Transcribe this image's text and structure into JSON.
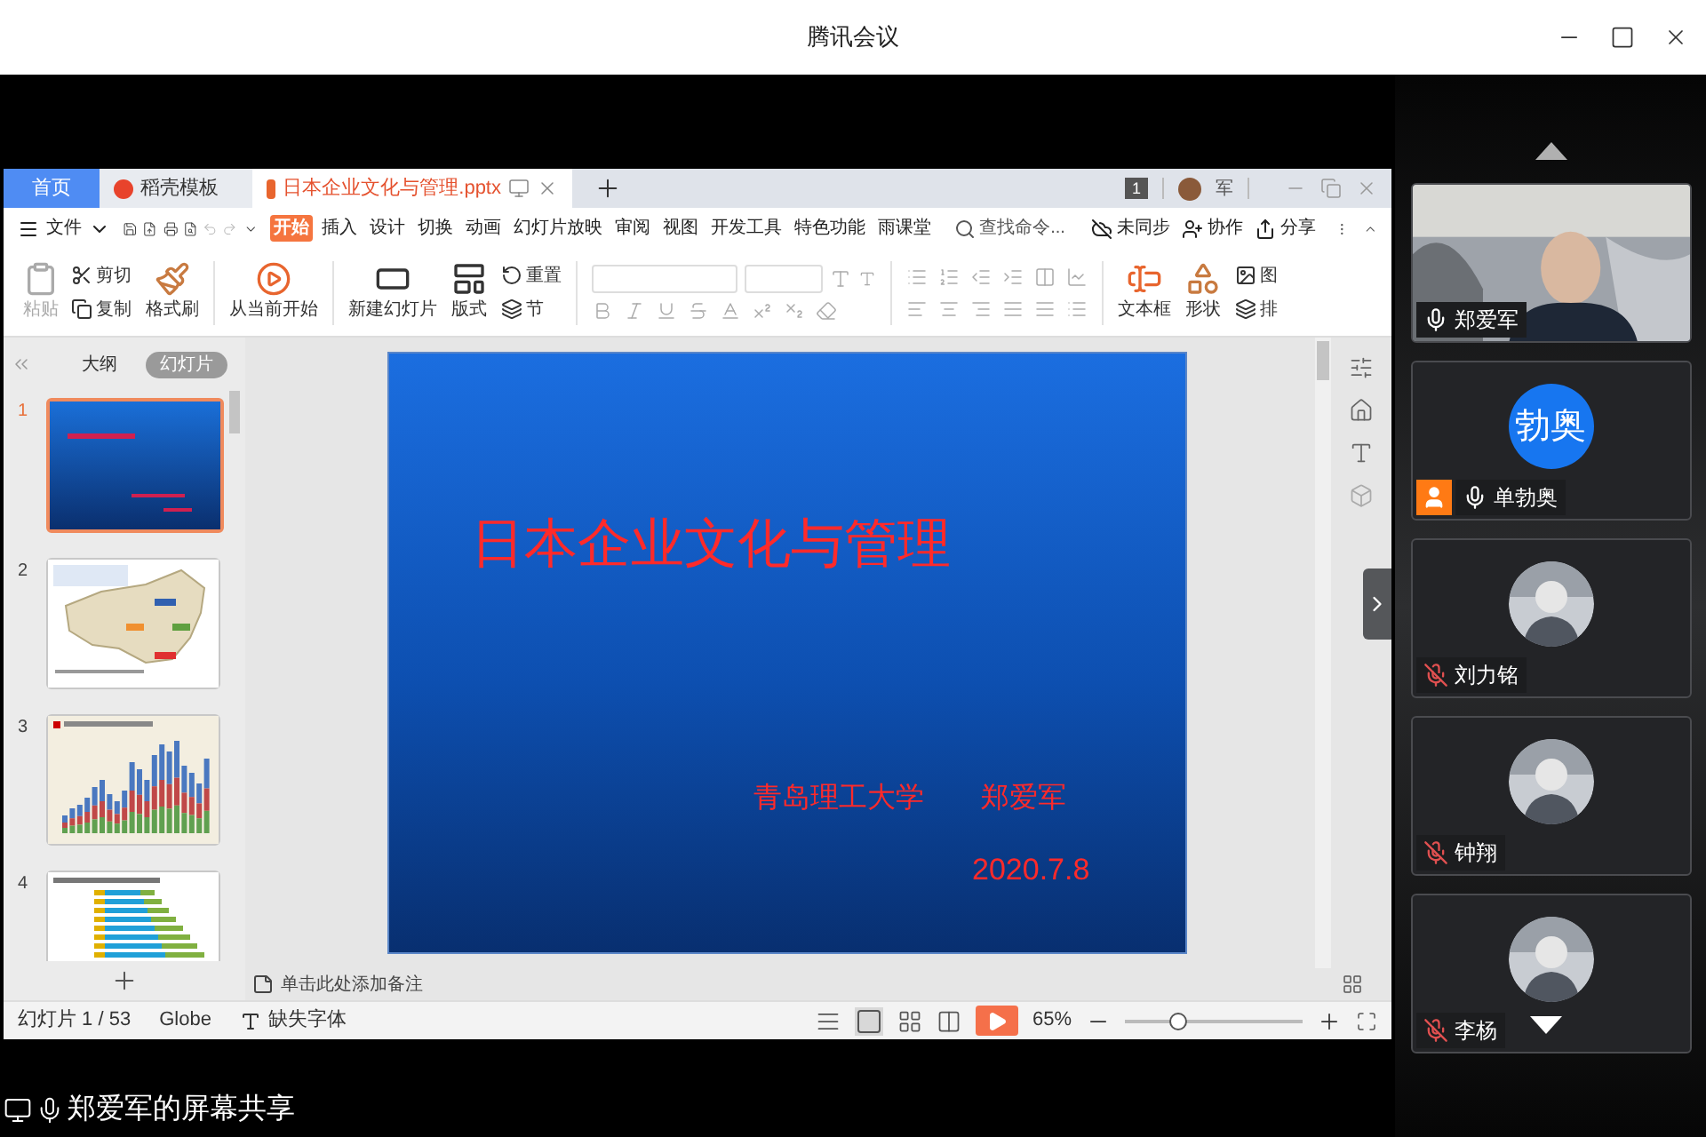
{
  "window": {
    "title": "腾讯会议"
  },
  "wps": {
    "tabs": [
      {
        "label": "首页",
        "kind": "home",
        "selected": false
      },
      {
        "label": "稻壳模板",
        "kind": "docer",
        "selected": false
      },
      {
        "label": "日本企业文化与管理.pptx",
        "kind": "document",
        "selected": true
      }
    ],
    "notification_count": "1",
    "user": "军",
    "menu": {
      "file": "文件",
      "tabs": [
        {
          "label": "开始",
          "selected": true
        },
        {
          "label": "插入",
          "selected": false
        },
        {
          "label": "设计",
          "selected": false
        },
        {
          "label": "切换",
          "selected": false
        },
        {
          "label": "动画",
          "selected": false
        },
        {
          "label": "幻灯片放映",
          "selected": false
        },
        {
          "label": "审阅",
          "selected": false
        },
        {
          "label": "视图",
          "selected": false
        },
        {
          "label": "开发工具",
          "selected": false
        },
        {
          "label": "特色功能",
          "selected": false
        },
        {
          "label": "雨课堂",
          "selected": false
        }
      ],
      "search": {
        "placeholder": "查找命令..."
      },
      "sync": "未同步",
      "collaborate": "协作",
      "share": "分享"
    },
    "ribbon": {
      "paste": "粘贴",
      "cut": "剪切",
      "copy": "复制",
      "format_painter": "格式刷",
      "play_from_current": "从当前开始",
      "new_slide": "新建幻灯片",
      "layout": "版式",
      "reset": "重置",
      "section": "节",
      "text_box": "文本框",
      "shape": "形状",
      "picture": "图",
      "arrange": "排"
    },
    "panel": {
      "tabs": [
        {
          "label": "大纲",
          "selected": false
        },
        {
          "label": "幻灯片",
          "selected": true
        }
      ],
      "thumbnails": [
        {
          "number": "1",
          "kind": "title",
          "selected": true
        },
        {
          "number": "2",
          "kind": "map",
          "selected": false
        },
        {
          "number": "3",
          "kind": "column_chart",
          "selected": false
        },
        {
          "number": "4",
          "kind": "bar_chart",
          "selected": false
        }
      ]
    },
    "slide": {
      "title": "日本企业文化与管理",
      "school": "青岛理工大学",
      "author": "郑爱军",
      "date": "2020.7.8"
    },
    "notes_placeholder": "单击此处添加备注",
    "status_bar": {
      "slide": "幻灯片 1 / 53",
      "theme": "Globe",
      "missing_fonts": "缺失字体",
      "zoom": "65%",
      "zoom_slider": {
        "level": 0.3
      }
    }
  },
  "share_label": "郑爱军的屏幕共享",
  "participants": [
    {
      "name": "郑爱军",
      "muted": false,
      "kind": "video",
      "host": false
    },
    {
      "name": "单勃奥",
      "muted": false,
      "kind": "initials",
      "initials": "勃奥",
      "host": true
    },
    {
      "name": "刘力铭",
      "muted": true,
      "kind": "picture",
      "host": false
    },
    {
      "name": "钟翔",
      "muted": true,
      "kind": "picture",
      "host": false
    },
    {
      "name": "李杨",
      "muted": true,
      "kind": "picture",
      "host": false
    }
  ]
}
